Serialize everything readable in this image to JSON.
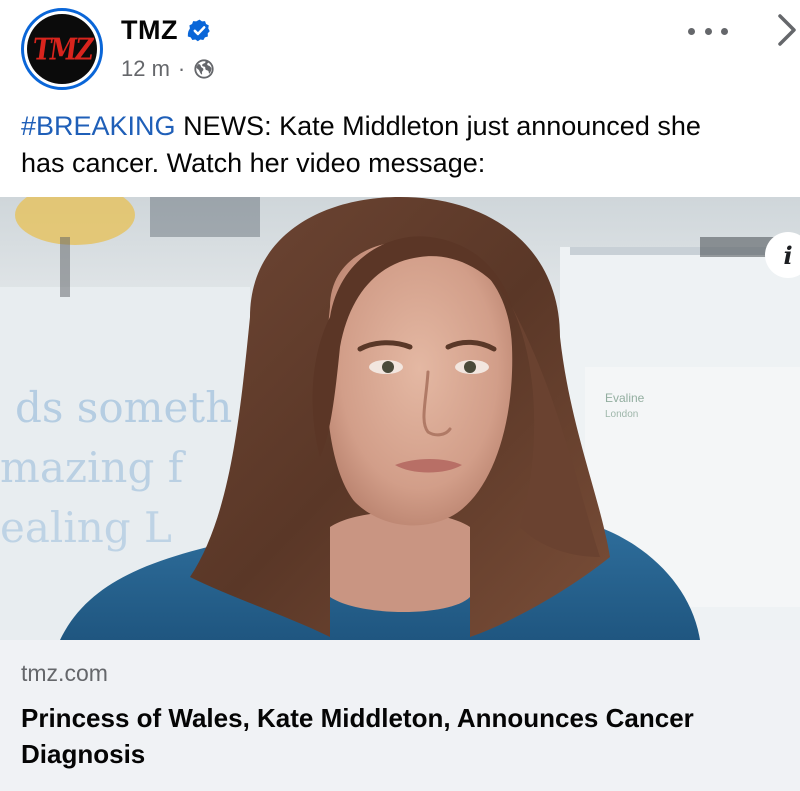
{
  "post": {
    "page_name": "TMZ",
    "avatar_logo_text": "TMZ",
    "timestamp": "12 m",
    "separator": "·",
    "privacy_icon": "globe-icon",
    "verified_icon": "verified-badge-icon",
    "more_icon": "more-horizontal-icon",
    "next_icon": "chevron-right-icon",
    "text": {
      "hashtag": "#BREAKING",
      "line1_rest": " NEWS: Kate Middleton just announced she",
      "line2": "has cancer. Watch her video message:"
    },
    "image": {
      "description_icon": "info-icon",
      "info_glyph": "i"
    },
    "link_preview": {
      "domain": "tmz.com",
      "title": "Princess of Wales, Kate Middleton, Announces Cancer Diagnosis"
    }
  },
  "colors": {
    "hashtag": "#1f5fb8",
    "verified": "#0a66d8",
    "secondary_text": "#65676b",
    "card_background": "#f0f2f5",
    "logo_red": "#d8241d"
  }
}
